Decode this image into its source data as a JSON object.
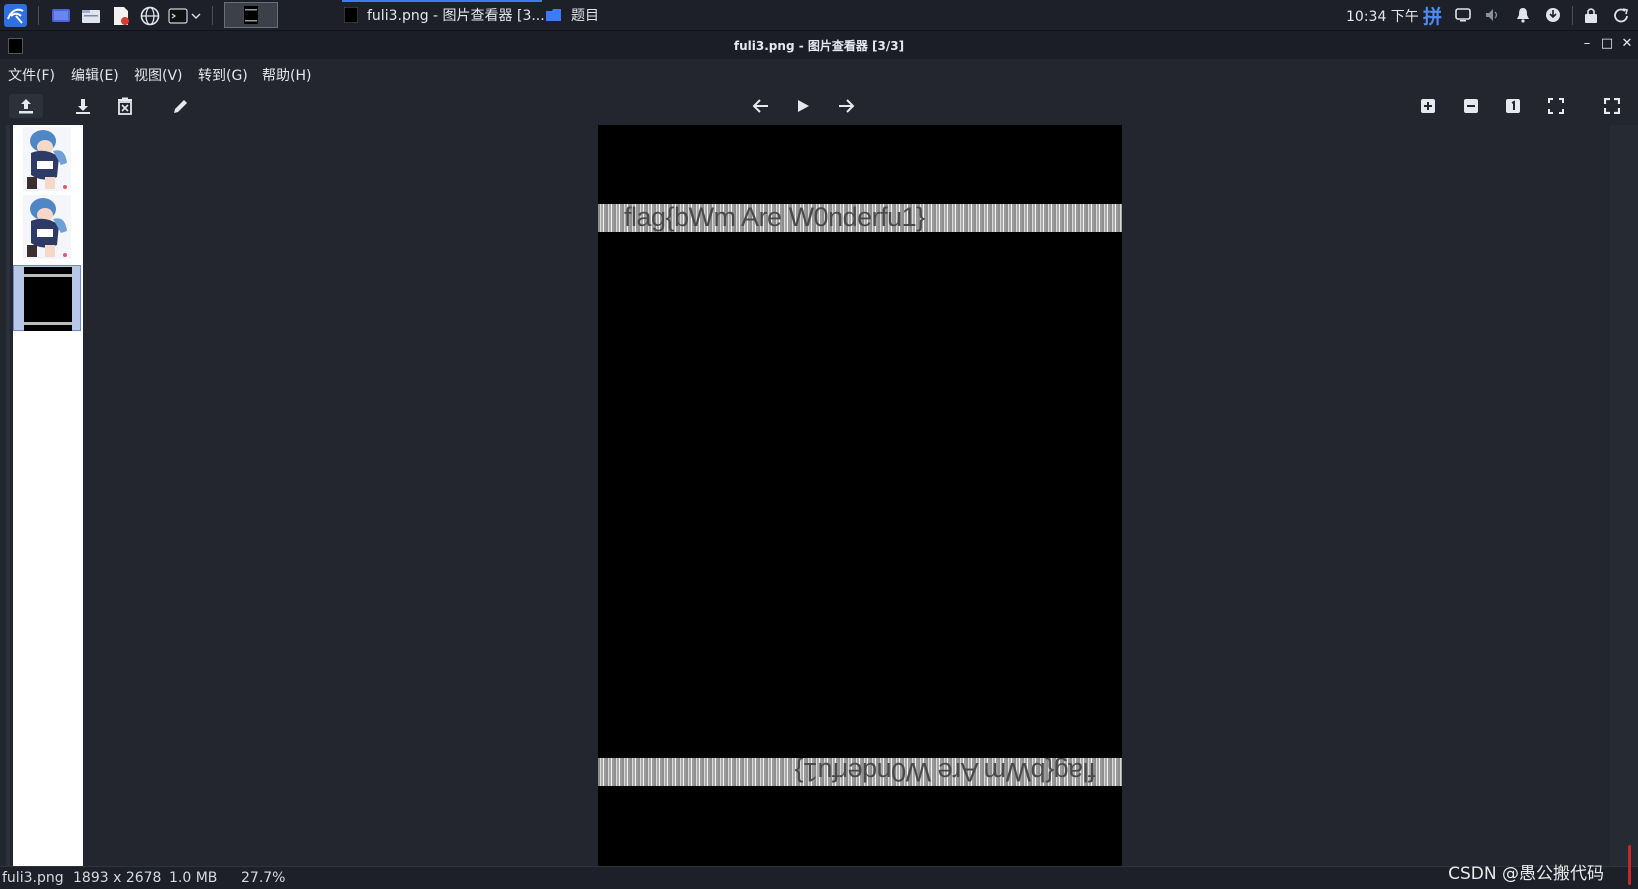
{
  "taskbar": {
    "active_task_label": "fuli3.png - 图片查看器 [3...",
    "folder_task_label": "题目",
    "clock": "10:34 下午",
    "input_method": "拼",
    "icons": [
      "kali-menu-icon",
      "desktop-icon",
      "file-manager-icon",
      "text-editor-icon",
      "browser-icon",
      "terminal-icon",
      "chevron-down-icon",
      "window-thumbnail-icon"
    ],
    "tray_icons": [
      "display-icon",
      "volume-icon",
      "bell-icon",
      "network-icon",
      "lock-icon",
      "power-icon"
    ],
    "accent": "#3c7bf0"
  },
  "window": {
    "title": "fuli3.png - 图片查看器 [3/3]",
    "minimize": "–",
    "maximize": "□",
    "close": "✕"
  },
  "menu": {
    "file": "文件(F)",
    "edit": "编辑(E)",
    "view": "视图(V)",
    "goto": "转到(G)",
    "help": "帮助(H)"
  },
  "toolbar": {
    "left_icons": [
      "upload-icon",
      "save-icon",
      "delete-icon",
      "edit-icon"
    ],
    "nav_icons": [
      "arrow-left-icon",
      "play-icon",
      "arrow-right-icon"
    ],
    "zoom_icons": [
      "zoom-in-icon",
      "zoom-out-icon",
      "actual-size-icon",
      "fit-icon",
      "fullscreen-icon"
    ]
  },
  "thumbnails": {
    "count": 3,
    "selected_index": 3
  },
  "image": {
    "top_text": "flag{bWm Are W0nderfu1}",
    "bottom_text": "flag{bWm Are W0nderfu1}",
    "background": "#000000"
  },
  "status": {
    "filename": "fuli3.png",
    "dimensions": "1893 x 2678",
    "size": "1.0 MB",
    "zoom": "27.7%"
  },
  "watermark": "CSDN @愚公搬代码"
}
